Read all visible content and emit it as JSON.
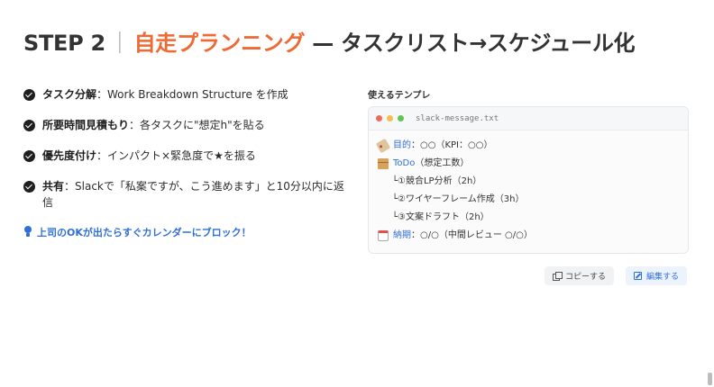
{
  "header": {
    "step": "STEP 2",
    "separator": "｜",
    "accent": "自走プランニング",
    "rest": " — タスクリスト→スケジュール化"
  },
  "steps": [
    {
      "label": "タスク分解",
      "text": "：Work Breakdown Structure を作成"
    },
    {
      "label": "所要時間見積もり",
      "text": "：各タスクに\"想定h\"を貼る"
    },
    {
      "label": "優先度付け",
      "text": "：インパクト×緊急度で★を振る"
    },
    {
      "label": "共有",
      "text": "：Slackで「私案ですが、こう進めます」と10分以内に返信"
    }
  ],
  "tip": "上司のOKが出たらすぐカレンダーにブロック！",
  "template": {
    "label": "使えるテンプレ",
    "filename": "slack-message.txt",
    "colors": {
      "red": "#ee6a5f",
      "yellow": "#f5bd4f",
      "green": "#61c454",
      "key": "#2f6fd9"
    },
    "lines": {
      "goal_key": "目的",
      "goal_val": "：○○（KPI：○○）",
      "todo_key": "ToDo",
      "todo_val": "（想定工数）",
      "todo_items": [
        "└①競合LP分析（2h）",
        "└②ワイヤーフレーム作成（3h）",
        "└③文案ドラフト（2h）"
      ],
      "due_key": "納期",
      "due_val": "：○/○（中間レビュー ○/○）"
    },
    "icons": [
      "label-tag-icon",
      "package-icon",
      "calendar-icon"
    ]
  },
  "actions": {
    "copy": "コピーする",
    "edit": "編集する"
  },
  "accent_color": "#ee6a35"
}
